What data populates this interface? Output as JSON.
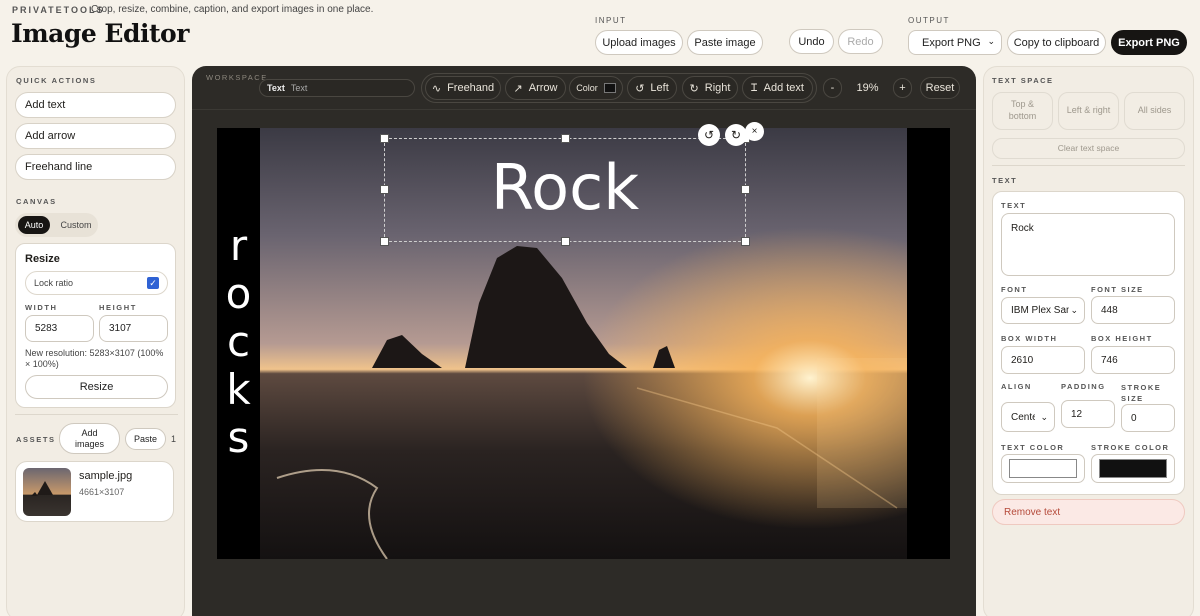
{
  "header": {
    "brand": "PRIVATETOOLS",
    "tagline": "Crop, resize, combine, caption, and export images in one place.",
    "title": "Image Editor",
    "input_label": "INPUT",
    "upload": "Upload images",
    "paste": "Paste image",
    "undo": "Undo",
    "redo": "Redo",
    "output_label": "OUTPUT",
    "format": "Export PNG",
    "copy": "Copy to clipboard",
    "export": "Export PNG"
  },
  "left": {
    "quick_actions_label": "QUICK ACTIONS",
    "add_text": "Add text",
    "add_arrow": "Add arrow",
    "freehand": "Freehand line",
    "canvas_label": "CANVAS",
    "auto": "Auto",
    "custom": "Custom",
    "resize_title": "Resize",
    "lock_ratio": "Lock ratio",
    "lock_checked": true,
    "width_label": "WIDTH",
    "height_label": "HEIGHT",
    "width": "5283",
    "height": "3107",
    "new_res_line1": "New resolution: 5283×3107 (100%",
    "new_res_line2": "× 100%)",
    "resize_btn": "Resize",
    "assets_label": "ASSETS",
    "add_images_1": "Add",
    "add_images_2": "images",
    "paste_btn": "Paste",
    "count": "1",
    "asset_name": "sample.jpg",
    "asset_dims": "4661×3107"
  },
  "workspace": {
    "label": "WORKSPACE",
    "text_tag": "Text",
    "text_input_placeholder": "Text",
    "freehand": "Freehand",
    "arrow": "Arrow",
    "color": "Color",
    "left": "Left",
    "right": "Right",
    "add_text": "Add text",
    "zoom_minus": "-",
    "zoom": "19%",
    "zoom_plus": "+",
    "reset": "Reset",
    "caption_main": "Rock",
    "vertical_letters": [
      "r",
      "o",
      "c",
      "k",
      "s"
    ],
    "colors": {
      "canvas_bg": "#2d2b27",
      "sky_top": "#3d3a43",
      "sun": "#f7b35a"
    }
  },
  "right": {
    "text_space_label": "TEXT SPACE",
    "top_bottom_1": "Top &",
    "top_bottom_2": "bottom",
    "left_right": "Left & right",
    "all_sides": "All sides",
    "clear_space": "Clear text space",
    "text_label": "TEXT",
    "text_field_label": "TEXT",
    "text_value": "Rock",
    "font_label": "FONT",
    "font_size_label": "FONT SIZE",
    "font_value": "IBM Plex Sans",
    "font_size": "448",
    "box_width_label": "BOX WIDTH",
    "box_height_label": "BOX HEIGHT",
    "box_width": "2610",
    "box_height": "746",
    "align_label": "ALIGN",
    "padding_label": "PADDING",
    "stroke_label_1": "STROKE",
    "stroke_label_2": "SIZE",
    "align_value": "Center",
    "padding": "12",
    "stroke_size": "0",
    "text_color_label": "TEXT COLOR",
    "stroke_color_label": "STROKE COLOR",
    "text_color": "#ffffff",
    "stroke_color": "#111111",
    "remove_text": "Remove text"
  }
}
